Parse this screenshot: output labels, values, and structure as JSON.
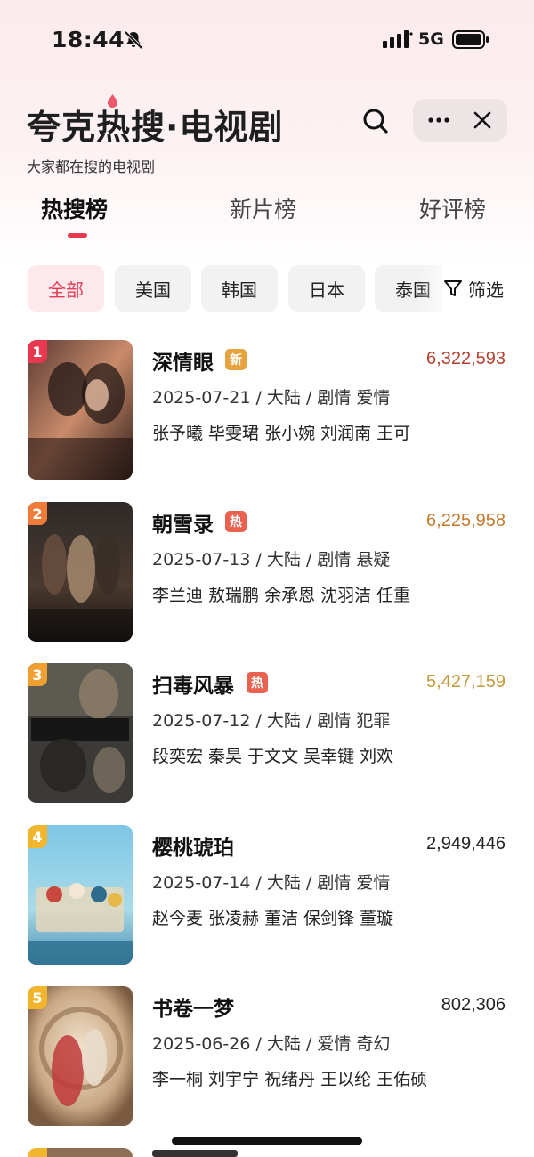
{
  "status_bar": {
    "time": "18:44",
    "network": "5G"
  },
  "header": {
    "title": "夸克热搜·电视剧",
    "subtitle": "大家都在搜的电视剧"
  },
  "tabs": [
    {
      "label": "热搜榜",
      "active": true
    },
    {
      "label": "新片榜",
      "active": false
    },
    {
      "label": "好评榜",
      "active": false
    }
  ],
  "filters": {
    "chips": [
      {
        "label": "全部",
        "active": true
      },
      {
        "label": "美国",
        "active": false
      },
      {
        "label": "韩国",
        "active": false
      },
      {
        "label": "日本",
        "active": false
      },
      {
        "label": "泰国",
        "active": false
      }
    ],
    "filter_label": "筛选"
  },
  "items": [
    {
      "rank": "1",
      "title": "深情眼",
      "badge": "新",
      "score": "6,322,593",
      "meta": "2025-07-21 / 大陆 / 剧情 爱情",
      "cast": "张予曦 毕雯珺 张小婉 刘润南 王可",
      "rank_color": "#e8384f",
      "badge_color": "#e6a23c",
      "score_color": "#b4412f"
    },
    {
      "rank": "2",
      "title": "朝雪录",
      "badge": "热",
      "score": "6,225,958",
      "meta": "2025-07-13 / 大陆 / 剧情 悬疑",
      "cast": "李兰迪 敖瑞鹏 余承恩 沈羽洁 任重",
      "rank_color": "#f07a3a",
      "badge_color": "#e8624f",
      "score_color": "#c47a2c"
    },
    {
      "rank": "3",
      "title": "扫毒风暴",
      "badge": "热",
      "score": "5,427,159",
      "meta": "2025-07-12 / 大陆 / 剧情 犯罪",
      "cast": "段奕宏 秦昊 于文文 吴幸键 刘欢",
      "rank_color": "#f0a030",
      "badge_color": "#e8624f",
      "score_color": "#c59a3c"
    },
    {
      "rank": "4",
      "title": "樱桃琥珀",
      "badge": "",
      "score": "2,949,446",
      "meta": "2025-07-14 / 大陆 / 剧情 爱情",
      "cast": "赵今麦 张凌赫 董洁 保剑锋 董璇",
      "rank_color": "#f2b52e",
      "badge_color": "",
      "score_color": "#222222"
    },
    {
      "rank": "5",
      "title": "书卷一梦",
      "badge": "",
      "score": "802,306",
      "meta": "2025-06-26 / 大陆 / 爱情 奇幻",
      "cast": "李一桐 刘宇宁 祝绪丹 王以纶 王佑硕",
      "rank_color": "#f2b52e",
      "badge_color": "",
      "score_color": "#222222"
    }
  ]
}
